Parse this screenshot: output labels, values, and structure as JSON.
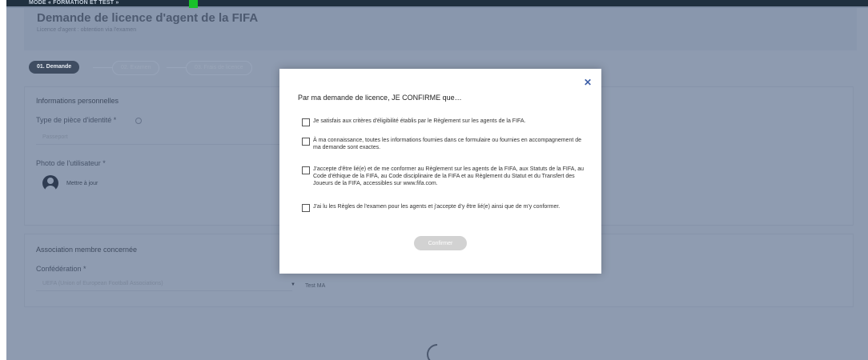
{
  "mode_banner": "MODE « FORMATION ET TEST »",
  "header": {
    "title": "Demande de licence d'agent de la FIFA",
    "subtitle": "Licence d'agent : obtention via l'examen"
  },
  "steps": [
    {
      "label": "01. Demande"
    },
    {
      "label": "02. Examen"
    },
    {
      "label": "03. Frais de licence"
    }
  ],
  "personal": {
    "section_title": "Informations personnelles",
    "id_type_label": "Type de pièce d'identité *",
    "id_type_value": "Passeport",
    "photo_label": "Photo de l'utilisateur *",
    "update_label": "Mettre à jour"
  },
  "association": {
    "section_title": "Association membre concernée",
    "confederation_label": "Confédération *",
    "confederation_value": "UEFA (Union of European Football Associations)",
    "association_value": "Test MA"
  },
  "modal": {
    "close_symbol": "✕",
    "title": "Par ma demande de licence, JE CONFIRME que…",
    "items": [
      {
        "text": "Je satisfais aux critères d'éligibilité établis par le Règlement sur les agents de la FIFA."
      },
      {
        "text": "À ma connaissance, toutes les informations fournies dans ce formulaire ou fournies en accompagnement de ma demande sont exactes."
      },
      {
        "text": "J'accepte d'être lié(e) et de me conformer au Règlement sur les agents de la FIFA, aux Statuts de la FIFA, au Code d'éthique de la FIFA, au Code disciplinaire de la FIFA et au Règlement du Statut et du Transfert des Joueurs de la FIFA, accessibles sur www.fifa.com."
      },
      {
        "text": "J'ai lu les Règles de l'examen pour les agents et j'accepte d'y être lié(e) ainsi que de m'y conformer."
      }
    ],
    "confirm_label": "Confirmer"
  }
}
